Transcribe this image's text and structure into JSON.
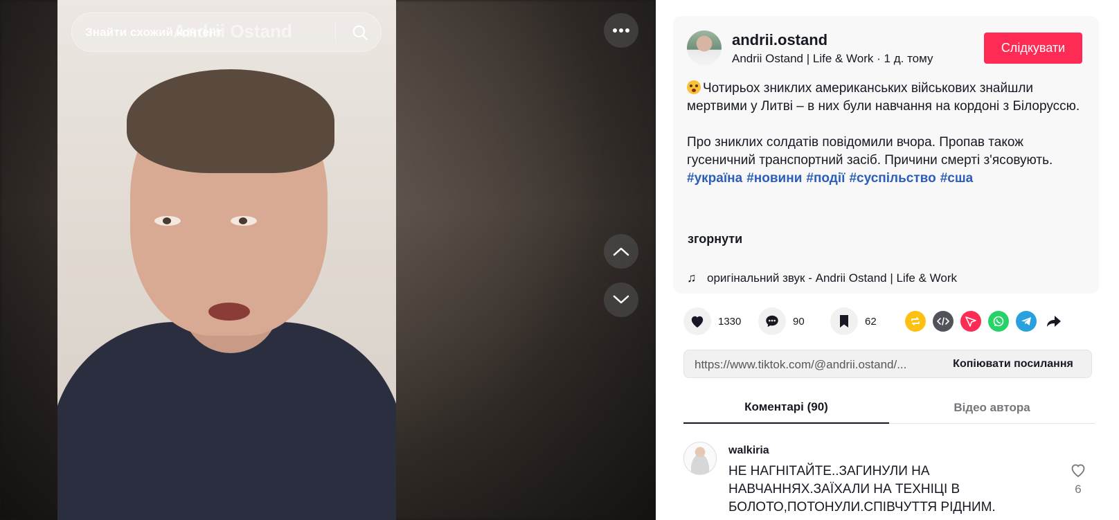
{
  "video": {
    "search_placeholder": "Знайти схожий контент",
    "watermark": "Andrii Ostand",
    "icons": {
      "search": "search-icon",
      "more": "more-horizontal-icon",
      "up": "chevron-up-icon",
      "down": "chevron-down-icon"
    }
  },
  "author": {
    "username": "andrii.ostand",
    "display_name": "Andrii Ostand | Life & Work",
    "time_ago": "1 д. тому",
    "follow_label": "Слідкувати"
  },
  "description": {
    "paragraph1": "Чотирьох зниклих американських військових знайшли мертвими у Литві – в них були навчання на кордоні з Білоруссю.",
    "paragraph2": "Про зниклих солдатів повідомили вчора. Пропав також гусеничний транспортний засіб. Причини смерті з'ясовують.",
    "hashtags": [
      "#україна",
      "#новини",
      "#події",
      "#суспільство",
      "#сша"
    ],
    "collapse_label": "згорнути",
    "music": "оригінальний звук - Andrii Ostand | Life & Work"
  },
  "stats": {
    "likes": "1330",
    "comments": "90",
    "saves": "62"
  },
  "share": {
    "icons": [
      "repost-icon",
      "embed-icon",
      "send-icon",
      "whatsapp-icon",
      "telegram-icon",
      "share-arrow-icon"
    ],
    "colors": [
      "#fcc111",
      "#52535a",
      "#fe2c55",
      "#25d366",
      "#2aa1df",
      "#161823"
    ]
  },
  "link": {
    "url": "https://www.tiktok.com/@andrii.ostand/...",
    "copy_label": "Копіювати посилання"
  },
  "tabs": {
    "comments": "Коментарі (90)",
    "author_videos": "Відео автора"
  },
  "comments": [
    {
      "username": "walkiria",
      "text": "НЕ НАГНІТАЙТЕ..ЗАГИНУЛИ НА НАВЧАННЯХ.ЗАЇХАЛИ НА ТЕХНІЦІ В БОЛОТО,ПОТОНУЛИ.СПІВЧУТТЯ РІДНИМ.",
      "likes": "6"
    }
  ],
  "colors": {
    "accent": "#fe2c55",
    "hashtag": "#2b5db9"
  }
}
